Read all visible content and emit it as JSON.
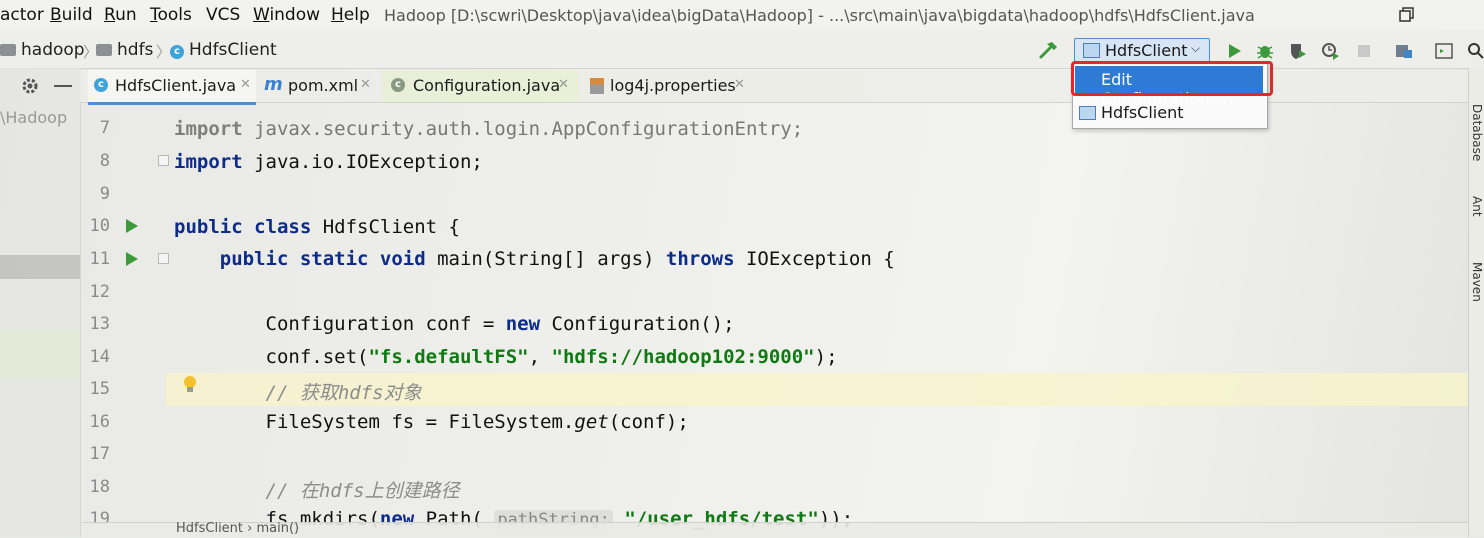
{
  "menu": {
    "items": [
      {
        "label": "actor",
        "underline": ""
      },
      {
        "label": "Build",
        "underline": "B"
      },
      {
        "label": "Run",
        "underline": "R"
      },
      {
        "label": "Tools",
        "underline": "T"
      },
      {
        "label": "VCS",
        "underline": ""
      },
      {
        "label": "Window",
        "underline": "W"
      },
      {
        "label": "Help",
        "underline": "H"
      }
    ],
    "window_title": "Hadoop [D:\\scwri\\Desktop\\java\\idea\\bigData\\Hadoop] - ...\\src\\main\\java\\bigdata\\hadoop\\hdfs\\HdfsClient.java"
  },
  "breadcrumb": {
    "items": [
      "hadoop",
      "hdfs",
      "HdfsClient"
    ]
  },
  "run_config": {
    "selected": "HdfsClient"
  },
  "dropdown": {
    "edit": "Edit Configurations...",
    "client": "HdfsClient"
  },
  "tabs": [
    {
      "label": "HdfsClient.java",
      "icon": "class-icon"
    },
    {
      "label": "pom.xml",
      "icon": "maven-icon"
    },
    {
      "label": "Configuration.java",
      "icon": "class-icon"
    },
    {
      "label": "log4j.properties",
      "icon": "properties-icon"
    }
  ],
  "project": {
    "path": "\\Hadoop"
  },
  "editor": {
    "lines": [
      {
        "n": "7"
      },
      {
        "n": "8"
      },
      {
        "n": "9"
      },
      {
        "n": "10"
      },
      {
        "n": "11"
      },
      {
        "n": "12"
      },
      {
        "n": "13"
      },
      {
        "n": "14"
      },
      {
        "n": "15"
      },
      {
        "n": "16"
      },
      {
        "n": "17"
      },
      {
        "n": "18"
      },
      {
        "n": "19"
      }
    ],
    "code": {
      "l7_kw": "import",
      "l7_rest": " javax.security.auth.login.AppConfigurationEntry;",
      "l8_kw": "import",
      "l8_rest": " java.io.IOException;",
      "l10_kw": "public class",
      "l10_rest": " HdfsClient {",
      "l11_kw1": "public static void",
      "l11_mid": " main(String[] args) ",
      "l11_kw2": "throws",
      "l11_rest": " IOException {",
      "l13_a": "Configuration conf = ",
      "l13_kw": "new",
      "l13_b": " Configuration();",
      "l14_a": "conf.set(",
      "l14_s1": "\"fs.defaultFS\"",
      "l14_b": ", ",
      "l14_s2": "\"hdfs://hadoop102:9000\"",
      "l14_c": ");",
      "l15": "// 获取hdfs对象",
      "l16_a": "FileSystem fs = FileSystem.",
      "l16_i": "get",
      "l16_b": "(conf);",
      "l18": "// 在hdfs上创建路径",
      "l19_a": "fs.mkdirs(",
      "l19_kw": "new",
      "l19_b": " Path( ",
      "l19_hint": "pathString:",
      "l19_s": " \"/user_hdfs/test\"",
      "l19_c": "));"
    }
  },
  "right_strip": [
    "Database",
    "Ant",
    "Maven"
  ],
  "bottom": {
    "path": "HdfsClient  ›  main()"
  }
}
